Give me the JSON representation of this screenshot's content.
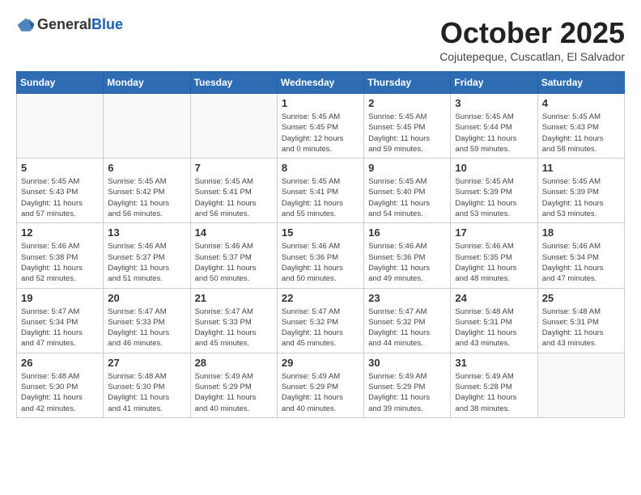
{
  "header": {
    "logo_general": "General",
    "logo_blue": "Blue",
    "month_title": "October 2025",
    "location": "Cojutepeque, Cuscatlan, El Salvador"
  },
  "weekdays": [
    "Sunday",
    "Monday",
    "Tuesday",
    "Wednesday",
    "Thursday",
    "Friday",
    "Saturday"
  ],
  "weeks": [
    [
      {
        "day": "",
        "info": ""
      },
      {
        "day": "",
        "info": ""
      },
      {
        "day": "",
        "info": ""
      },
      {
        "day": "1",
        "info": "Sunrise: 5:45 AM\nSunset: 5:45 PM\nDaylight: 12 hours\nand 0 minutes."
      },
      {
        "day": "2",
        "info": "Sunrise: 5:45 AM\nSunset: 5:45 PM\nDaylight: 11 hours\nand 59 minutes."
      },
      {
        "day": "3",
        "info": "Sunrise: 5:45 AM\nSunset: 5:44 PM\nDaylight: 11 hours\nand 59 minutes."
      },
      {
        "day": "4",
        "info": "Sunrise: 5:45 AM\nSunset: 5:43 PM\nDaylight: 11 hours\nand 58 minutes."
      }
    ],
    [
      {
        "day": "5",
        "info": "Sunrise: 5:45 AM\nSunset: 5:43 PM\nDaylight: 11 hours\nand 57 minutes."
      },
      {
        "day": "6",
        "info": "Sunrise: 5:45 AM\nSunset: 5:42 PM\nDaylight: 11 hours\nand 56 minutes."
      },
      {
        "day": "7",
        "info": "Sunrise: 5:45 AM\nSunset: 5:41 PM\nDaylight: 11 hours\nand 56 minutes."
      },
      {
        "day": "8",
        "info": "Sunrise: 5:45 AM\nSunset: 5:41 PM\nDaylight: 11 hours\nand 55 minutes."
      },
      {
        "day": "9",
        "info": "Sunrise: 5:45 AM\nSunset: 5:40 PM\nDaylight: 11 hours\nand 54 minutes."
      },
      {
        "day": "10",
        "info": "Sunrise: 5:45 AM\nSunset: 5:39 PM\nDaylight: 11 hours\nand 53 minutes."
      },
      {
        "day": "11",
        "info": "Sunrise: 5:45 AM\nSunset: 5:39 PM\nDaylight: 11 hours\nand 53 minutes."
      }
    ],
    [
      {
        "day": "12",
        "info": "Sunrise: 5:46 AM\nSunset: 5:38 PM\nDaylight: 11 hours\nand 52 minutes."
      },
      {
        "day": "13",
        "info": "Sunrise: 5:46 AM\nSunset: 5:37 PM\nDaylight: 11 hours\nand 51 minutes."
      },
      {
        "day": "14",
        "info": "Sunrise: 5:46 AM\nSunset: 5:37 PM\nDaylight: 11 hours\nand 50 minutes."
      },
      {
        "day": "15",
        "info": "Sunrise: 5:46 AM\nSunset: 5:36 PM\nDaylight: 11 hours\nand 50 minutes."
      },
      {
        "day": "16",
        "info": "Sunrise: 5:46 AM\nSunset: 5:36 PM\nDaylight: 11 hours\nand 49 minutes."
      },
      {
        "day": "17",
        "info": "Sunrise: 5:46 AM\nSunset: 5:35 PM\nDaylight: 11 hours\nand 48 minutes."
      },
      {
        "day": "18",
        "info": "Sunrise: 5:46 AM\nSunset: 5:34 PM\nDaylight: 11 hours\nand 47 minutes."
      }
    ],
    [
      {
        "day": "19",
        "info": "Sunrise: 5:47 AM\nSunset: 5:34 PM\nDaylight: 11 hours\nand 47 minutes."
      },
      {
        "day": "20",
        "info": "Sunrise: 5:47 AM\nSunset: 5:33 PM\nDaylight: 11 hours\nand 46 minutes."
      },
      {
        "day": "21",
        "info": "Sunrise: 5:47 AM\nSunset: 5:33 PM\nDaylight: 11 hours\nand 45 minutes."
      },
      {
        "day": "22",
        "info": "Sunrise: 5:47 AM\nSunset: 5:32 PM\nDaylight: 11 hours\nand 45 minutes."
      },
      {
        "day": "23",
        "info": "Sunrise: 5:47 AM\nSunset: 5:32 PM\nDaylight: 11 hours\nand 44 minutes."
      },
      {
        "day": "24",
        "info": "Sunrise: 5:48 AM\nSunset: 5:31 PM\nDaylight: 11 hours\nand 43 minutes."
      },
      {
        "day": "25",
        "info": "Sunrise: 5:48 AM\nSunset: 5:31 PM\nDaylight: 11 hours\nand 43 minutes."
      }
    ],
    [
      {
        "day": "26",
        "info": "Sunrise: 5:48 AM\nSunset: 5:30 PM\nDaylight: 11 hours\nand 42 minutes."
      },
      {
        "day": "27",
        "info": "Sunrise: 5:48 AM\nSunset: 5:30 PM\nDaylight: 11 hours\nand 41 minutes."
      },
      {
        "day": "28",
        "info": "Sunrise: 5:49 AM\nSunset: 5:29 PM\nDaylight: 11 hours\nand 40 minutes."
      },
      {
        "day": "29",
        "info": "Sunrise: 5:49 AM\nSunset: 5:29 PM\nDaylight: 11 hours\nand 40 minutes."
      },
      {
        "day": "30",
        "info": "Sunrise: 5:49 AM\nSunset: 5:29 PM\nDaylight: 11 hours\nand 39 minutes."
      },
      {
        "day": "31",
        "info": "Sunrise: 5:49 AM\nSunset: 5:28 PM\nDaylight: 11 hours\nand 38 minutes."
      },
      {
        "day": "",
        "info": ""
      }
    ]
  ]
}
